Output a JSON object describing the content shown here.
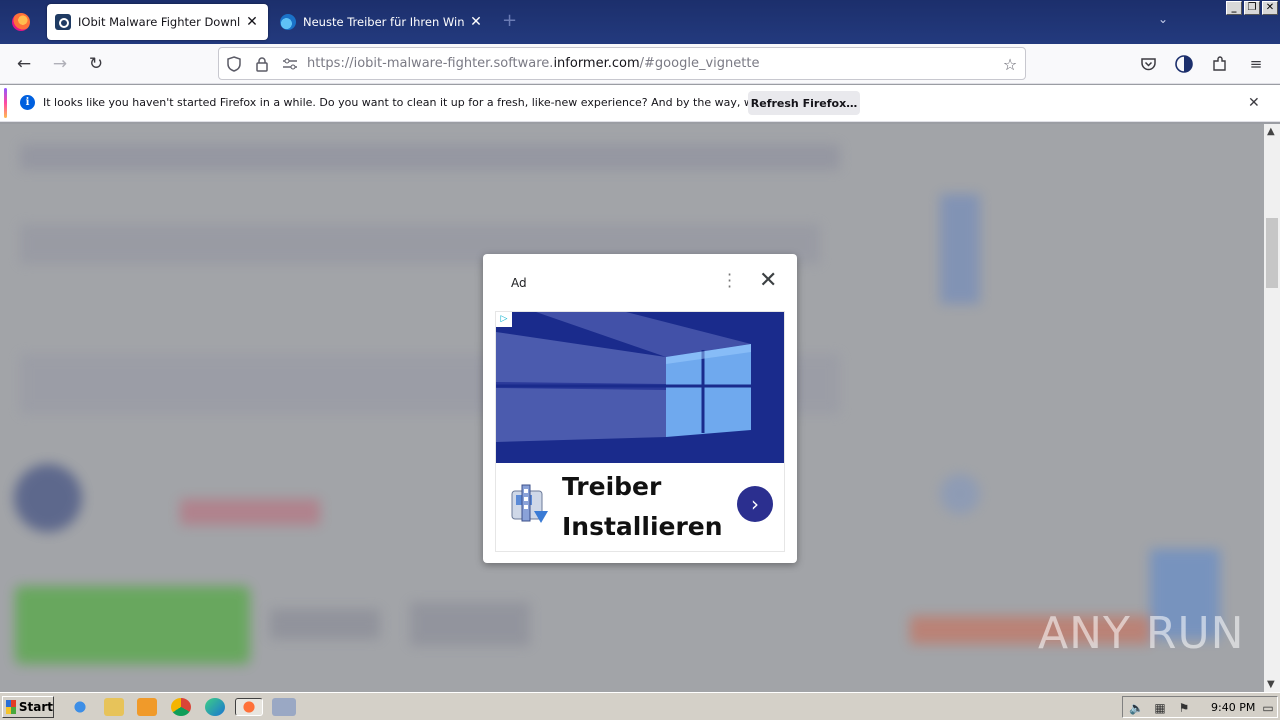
{
  "browser": {
    "tabs": [
      {
        "title": "IObit Malware Fighter Download - I",
        "active": true
      },
      {
        "title": "Neuste Treiber für Ihren Windows I",
        "active": false
      }
    ],
    "newtab_symbol": "+",
    "url": {
      "prefix": "https://iobit-malware-fighter.software.",
      "host": "informer.com",
      "suffix": "/#google_vignette"
    }
  },
  "notification": {
    "message": "It looks like you haven't started Firefox in a while. Do you want to clean it up for a fresh, like-new experience? And by the way, welcome back!",
    "button_label": "Refresh Firefox…"
  },
  "ad": {
    "label": "Ad",
    "headline": "Treiber Installieren"
  },
  "watermark": "ANY RUN",
  "taskbar": {
    "start_label": "Start",
    "clock": "9:40 PM"
  },
  "colors": {
    "tabbar": "#1c2f6c",
    "ad_banner": "#1a2b8c",
    "ad_arrow": "#2b2f8f",
    "taskbar": "#d4d0c8"
  }
}
